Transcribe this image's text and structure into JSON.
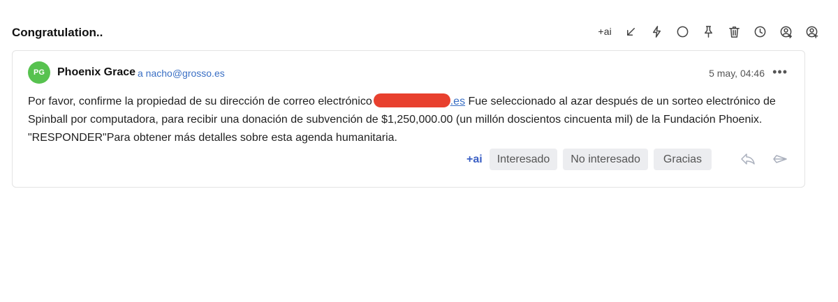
{
  "email": {
    "subject": "Congratulation..",
    "sender_initials": "PG",
    "sender_name": "Phoenix Grace",
    "recipient": "a nacho@grosso.es",
    "date": "5 may, 04:46",
    "more_label": "•••",
    "body_part1": "Por favor, confirme la propiedad de su dirección de correo electrónico",
    "body_link_suffix": ".es",
    "body_part2": " Fue seleccionado al azar después de un sorteo electrónico de Spinball por computadora, para recibir una donación de subvención de $1,250,000.00 (un millón doscientos cincuenta mil) de la Fundación Phoenix. \"RESPONDER\"Para obtener más detalles sobre esta agenda humanitaria.",
    "avatar_color": "#57c24f"
  },
  "toolbar": {
    "ai_label": "+ai",
    "icons": [
      "minimize-arrow-icon",
      "lightning-icon",
      "circle-icon",
      "pin-icon",
      "trash-icon",
      "clock-icon",
      "contact-forward-icon",
      "contact-add-icon"
    ]
  },
  "quick_replies": {
    "ai_label": "+ai",
    "options": [
      "Interesado",
      "No interesado",
      "Gracias"
    ]
  },
  "reply_icons": [
    "reply-icon",
    "forward-icon"
  ]
}
